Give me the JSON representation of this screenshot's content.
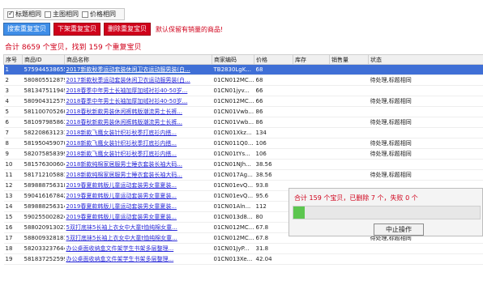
{
  "options": [
    {
      "label": "标题相同",
      "checked": true
    },
    {
      "label": "主图相同",
      "checked": false
    },
    {
      "label": "价格相同",
      "checked": false
    }
  ],
  "toolbar": {
    "buttons": [
      {
        "label": "搜索重复宝贝",
        "color": "#3f8ee8"
      },
      {
        "label": "下架重复宝贝",
        "color": "#d0021b"
      },
      {
        "label": "删除重复宝贝",
        "color": "#d0021b"
      }
    ],
    "note": "默认保留有销量的商品!"
  },
  "summary": "合计 8659 个宝贝，找到 159 个重复宝贝",
  "table": {
    "columns": [
      "序号",
      "商品ID",
      "商品名称",
      "商家编码",
      "价格",
      "库存",
      "销售量",
      "状态"
    ],
    "rows": [
      {
        "no": "1",
        "id": "575944538655",
        "name": "2017新款秋季运动套装休闲卫衣运动服男装(白...",
        "code": "TB2830LgK...",
        "price": "68",
        "stock": "",
        "sales": "",
        "status": ""
      },
      {
        "no": "2",
        "id": "580805512879",
        "name": "2017新款秋季运动套装休闲卫衣运动服男装(白...",
        "code": "01CN012MC...",
        "price": "68",
        "stock": "",
        "sales": "",
        "status": "待处理,标题相同"
      },
      {
        "no": "3",
        "id": "581347511949",
        "name": "2018春季中年男士长袖加厚加绒衬衫40-50岁...",
        "code": "01CN01jyv...",
        "price": "66",
        "stock": "",
        "sales": "",
        "status": ""
      },
      {
        "no": "4",
        "id": "580904312579",
        "name": "2018春季中年男士长袖加厚加绒衬衫40-50岁...",
        "code": "01CN012MC...",
        "price": "66",
        "stock": "",
        "sales": "",
        "status": "待处理,标题相同"
      },
      {
        "no": "5",
        "id": "581100705260",
        "name": "2018春秋新款男装休闲裤韩版潮流男士长裤...",
        "code": "01CN01Vwb...",
        "price": "86",
        "stock": "",
        "sales": "",
        "status": ""
      },
      {
        "no": "6",
        "id": "581097985863",
        "name": "2018春秋新款男装休闲裤韩版潮流男士长裤...",
        "code": "01CN01Vwb...",
        "price": "86",
        "stock": "",
        "sales": "",
        "status": "待处理,标题相同"
      },
      {
        "no": "7",
        "id": "582208631231",
        "name": "2018新款飞鹰女装针织衫秋季打底衫内搭...",
        "code": "01CN01Xkz...",
        "price": "134",
        "stock": "",
        "sales": "",
        "status": ""
      },
      {
        "no": "8",
        "id": "581950459070",
        "name": "2018新款飞鹰女装针织衫秋季打底衫内搭...",
        "code": "01CN011Q0...",
        "price": "106",
        "stock": "",
        "sales": "",
        "status": "待处理,标题相同"
      },
      {
        "no": "9",
        "id": "582075858399",
        "name": "2018新款飞鹰女装针织衫秋季打底衫内搭...",
        "code": "01CN01tYs...",
        "price": "106",
        "stock": "",
        "sales": "",
        "status": "待处理,标题相同"
      },
      {
        "no": "10",
        "id": "581576300604",
        "name": "2018新款纯棉家居服男士睡衣套装长袖大码...",
        "code": "01CN01NJh...",
        "price": "38.56",
        "stock": "",
        "sales": "",
        "status": ""
      },
      {
        "no": "11",
        "id": "581712105881",
        "name": "2018新款纯棉家居服男士睡衣套装长袖大码...",
        "code": "01CN017Ag...",
        "price": "38.56",
        "stock": "",
        "sales": "",
        "status": "待处理,标题相同"
      },
      {
        "no": "12",
        "id": "589888756318",
        "name": "2019春夏款韩版儿童运动套装男女童夏装...",
        "code": "01CN01evQ...",
        "price": "93.8",
        "stock": "",
        "sales": "",
        "status": ""
      },
      {
        "no": "13",
        "id": "590416167842",
        "name": "2019春夏款韩版儿童运动套装男女童夏装...",
        "code": "01CN01evQ...",
        "price": "95.6",
        "stock": "",
        "sales": "",
        "status": ""
      },
      {
        "no": "14",
        "id": "589888256314",
        "name": "2019春夏款韩版儿童运动套装男女童夏装...",
        "code": "01CN01Aln...",
        "price": "112",
        "stock": "",
        "sales": "",
        "status": ""
      },
      {
        "no": "15",
        "id": "590255002824",
        "name": "2019春夏款韩版儿童运动套装男女童夏装...",
        "code": "01CN013d8...",
        "price": "80",
        "stock": "",
        "sales": "",
        "status": ""
      },
      {
        "no": "16",
        "id": "588020913023",
        "name": "5双打底袜5长袖上衣女中大童t恤纯棉女童...",
        "code": "01CN012MC...",
        "price": "67.8",
        "stock": "",
        "sales": "",
        "status": "待处理,标题相同"
      },
      {
        "no": "17",
        "id": "588009328181",
        "name": "5双打底袜5长袖上衣女中大童t恤纯棉女童...",
        "code": "01CN012MC...",
        "price": "67.8",
        "stock": "",
        "sales": "",
        "status": "待处理,标题相同"
      },
      {
        "no": "18",
        "id": "582033237644",
        "name": "办公桌面收纳盒文件架学生书架多层整理...",
        "code": "01CN01JyP...",
        "price": "31.8",
        "stock": "",
        "sales": "",
        "status": ""
      },
      {
        "no": "19",
        "id": "581837252599",
        "name": "办公桌面收纳盒文件架学生书架多层整理...",
        "code": "01CN013Xe...",
        "price": "42.04",
        "stock": "",
        "sales": "",
        "status": ""
      }
    ]
  },
  "dialog": {
    "message": "合计 159 个宝贝，已删除 7 个，失败 0 个",
    "progress": 0.06,
    "stop_label": "中止操作",
    "bar_color": "#5cc64f"
  }
}
